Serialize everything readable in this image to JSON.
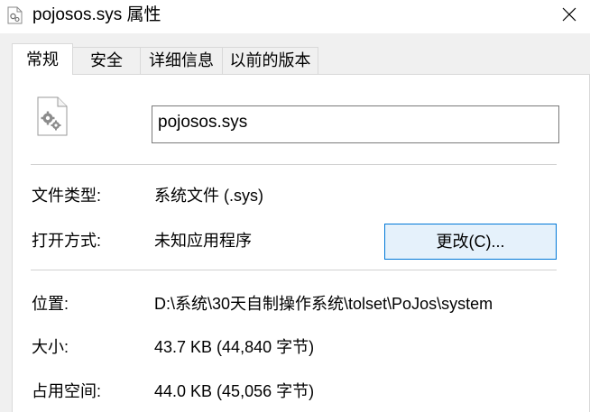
{
  "window": {
    "title": "pojosos.sys 属性",
    "close_glyph": "✕"
  },
  "tabs": [
    {
      "label": "常规",
      "active": true
    },
    {
      "label": "安全",
      "active": false
    },
    {
      "label": "详细信息",
      "active": false
    },
    {
      "label": "以前的版本",
      "active": false
    }
  ],
  "general": {
    "file_name": "pojosos.sys",
    "file_type_label": "文件类型:",
    "file_type_value": "系统文件 (.sys)",
    "opens_with_label": "打开方式:",
    "opens_with_value": "未知应用程序",
    "change_button": "更改(C)...",
    "location_label": "位置:",
    "location_value": "D:\\系统\\30天自制操作系统\\tolset\\PoJos\\system",
    "size_label": "大小:",
    "size_value": "43.7 KB (44,840 字节)",
    "size_on_disk_label": "占用空间:",
    "size_on_disk_value": "44.0 KB (45,056 字节)"
  },
  "icons": {
    "title_icon": "system-file-icon",
    "file_icon": "system-file-gears-icon",
    "close": "close-icon"
  },
  "colors": {
    "button_border": "#0078d7",
    "button_bg": "#e5f1fb",
    "dialog_bg": "#f0f0f0"
  }
}
